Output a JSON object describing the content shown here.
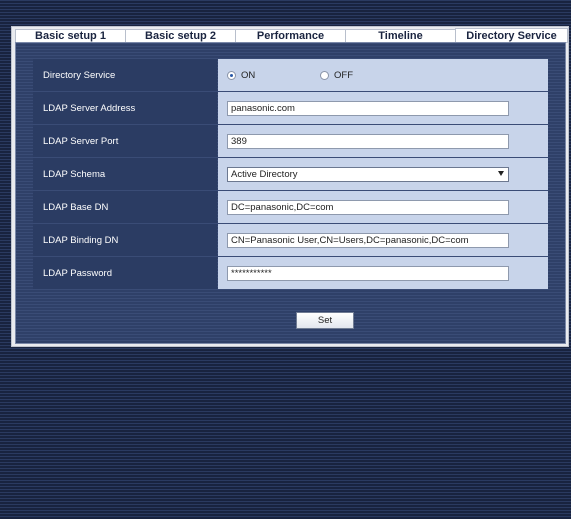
{
  "tabs": [
    {
      "label": "Basic setup 1",
      "active": false
    },
    {
      "label": "Basic setup 2",
      "active": false
    },
    {
      "label": "Performance",
      "active": false
    },
    {
      "label": "Timeline",
      "active": false
    },
    {
      "label": "Directory Service",
      "active": true
    }
  ],
  "form": {
    "directory_service": {
      "label": "Directory Service",
      "on_label": "ON",
      "off_label": "OFF",
      "selected": "ON"
    },
    "ldap_server_address": {
      "label": "LDAP Server Address",
      "value": "panasonic.com"
    },
    "ldap_server_port": {
      "label": "LDAP Server Port",
      "value": "389"
    },
    "ldap_schema": {
      "label": "LDAP Schema",
      "value": "Active Directory"
    },
    "ldap_base_dn": {
      "label": "LDAP Base DN",
      "value": "DC=panasonic,DC=com"
    },
    "ldap_binding_dn": {
      "label": "LDAP Binding DN",
      "value": "CN=Panasonic User,CN=Users,DC=panasonic,DC=com"
    },
    "ldap_password": {
      "label": "LDAP Password",
      "value": "***********"
    }
  },
  "buttons": {
    "set_label": "Set"
  },
  "colors": {
    "accent": "#2a5aa8",
    "panel": "#33456e",
    "label_cell": "#2b3c63",
    "value_cell": "#c8d4ea"
  }
}
